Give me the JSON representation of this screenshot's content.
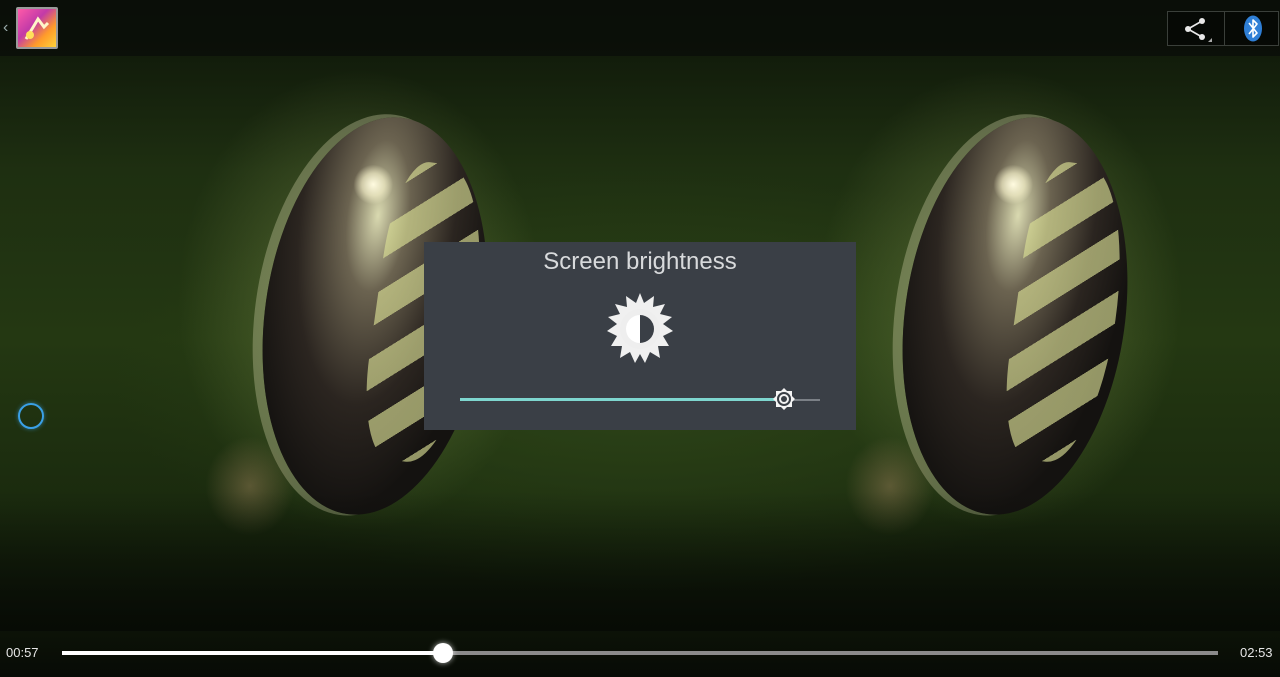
{
  "topbar": {
    "back_icon": "chevron-left-icon",
    "app_icon": "gallery-app-icon",
    "actions": [
      {
        "icon": "share-icon"
      },
      {
        "icon": "bluetooth-icon"
      }
    ]
  },
  "brightness_dialog": {
    "title": "Screen brightness",
    "icon": "brightness-sun-icon",
    "level": 0.9,
    "colors": {
      "background": "#3a3f46",
      "slider_fill": "#7ed6cf",
      "slider_track": "#7b8086"
    }
  },
  "playback": {
    "current_time": "00:57",
    "total_time": "02:53",
    "progress": 0.33
  },
  "touch_indicator": {
    "icon": "touch-ring-icon",
    "color": "#3aa0e6"
  }
}
